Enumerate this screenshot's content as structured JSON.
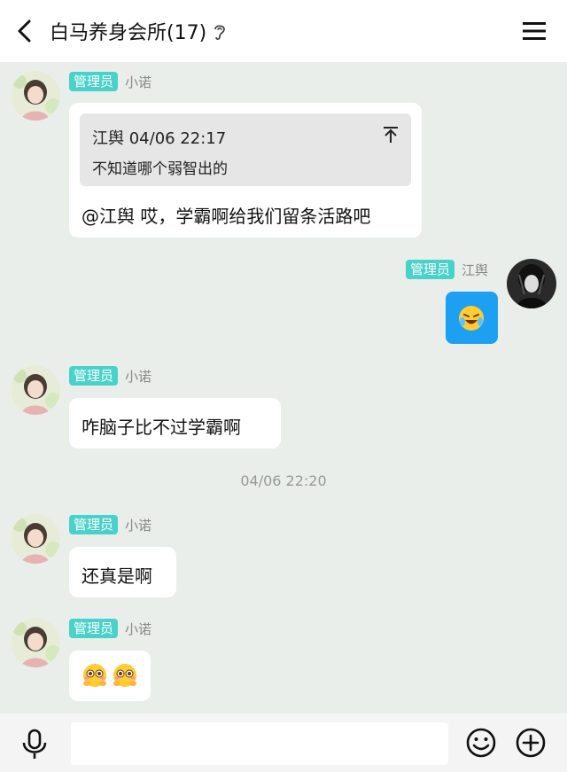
{
  "header": {
    "title": "白马养身会所(17)",
    "back_icon": "chevron-left-icon",
    "ear_icon": "ear-icon",
    "menu_icon": "hamburger-menu-icon"
  },
  "messages": [
    {
      "badge": "管理员",
      "sender": "小诺",
      "quote": {
        "author_time": "江舆 04/06 22:17",
        "text": "不知道哪个弱智出的"
      },
      "text": "@江舆 哎，学霸啊给我们留条活路吧"
    },
    {
      "badge": "管理员",
      "sender": "江舆",
      "emoji": "laughing-crying-emoji"
    },
    {
      "badge": "管理员",
      "sender": "小诺",
      "text": "咋脑子比不过学霸啊"
    },
    {
      "badge": "管理员",
      "sender": "小诺",
      "text": "还真是啊"
    },
    {
      "badge": "管理员",
      "sender": "小诺",
      "emoji": "pleading-emoji"
    }
  ],
  "timestamp": "04/06 22:20",
  "footer": {
    "mic_icon": "microphone-icon",
    "input_value": "",
    "emoji_icon": "smiley-icon",
    "plus_icon": "plus-circle-icon"
  },
  "colors": {
    "badge": "#49d2c9",
    "background": "#e9eeea",
    "blue_bubble": "#1ea0f2"
  }
}
